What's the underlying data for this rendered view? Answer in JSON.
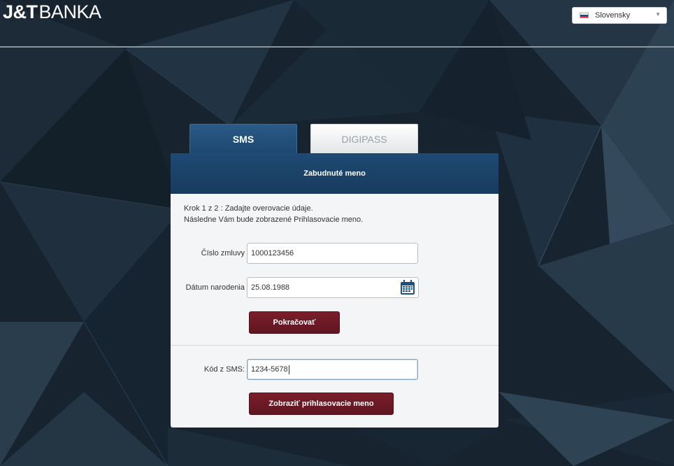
{
  "brand": {
    "logo_bold": "J&T",
    "logo_rest": "BANKA"
  },
  "language": {
    "selected": "Slovensky",
    "flag_icon": "slovak-flag-icon"
  },
  "tabs": [
    {
      "label": "SMS",
      "active": true
    },
    {
      "label": "DIGIPASS",
      "active": false
    }
  ],
  "panel": {
    "title": "Zabudnuté meno",
    "instruction_line1": "Krok 1 z 2 : Zadajte overovacie údaje.",
    "instruction_line2": "Následne Vám bude zobrazené Prihlasovacie meno."
  },
  "form": {
    "contract_label": "Číslo zmluvy",
    "contract_value": "1000123456",
    "birth_label": "Dátum narodenia",
    "birth_value": "25.08.1988",
    "continue_label": "Pokračovať",
    "sms_label": "Kód z SMS:",
    "sms_value": "1234-5678",
    "show_label": "Zobraziť prihlasovacie meno"
  },
  "colors": {
    "accent_blue": "#1c4770",
    "button_red": "#6d1a25",
    "background": "#16222d"
  }
}
